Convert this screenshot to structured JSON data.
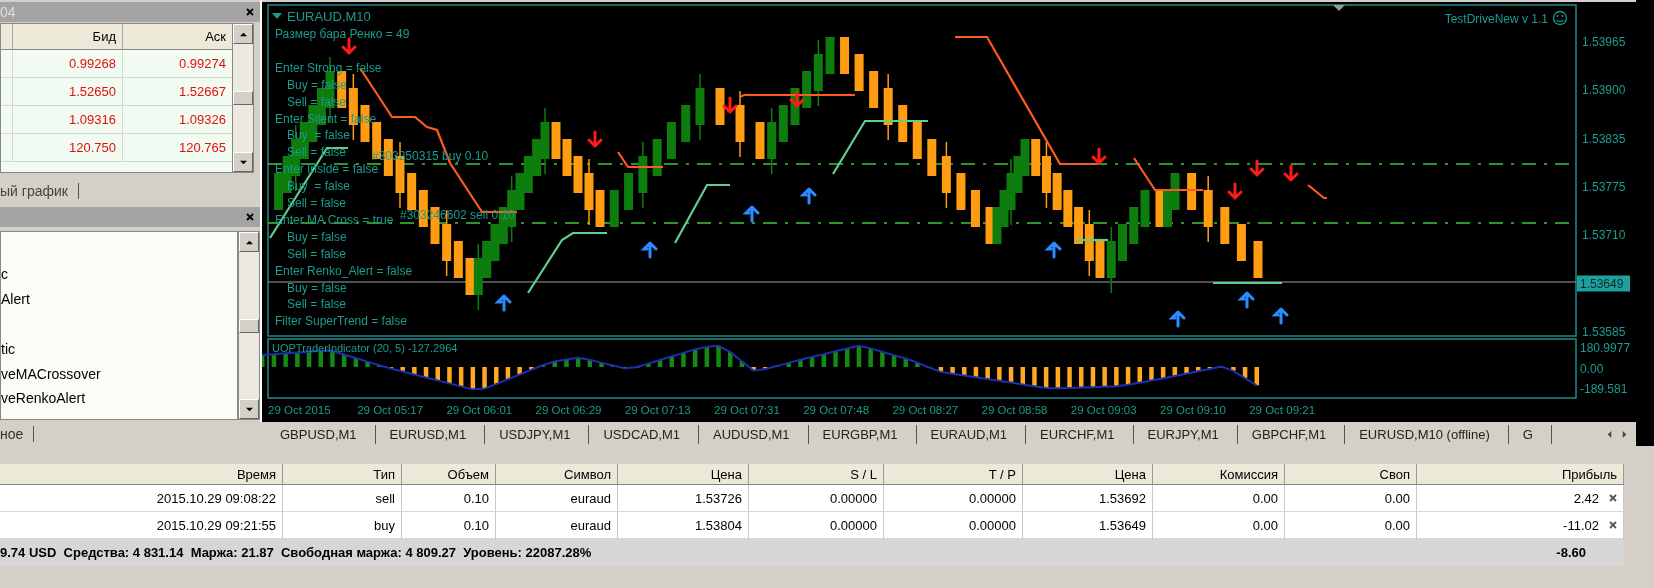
{
  "market_watch": {
    "title": "04",
    "columns": [
      "Бид",
      "Аск"
    ],
    "rows": [
      {
        "bid": "0.99268",
        "ask": "0.99274"
      },
      {
        "bid": "1.52650",
        "ask": "1.52667"
      },
      {
        "bid": "1.09316",
        "ask": "1.09326"
      },
      {
        "bid": "120.750",
        "ask": "120.765"
      }
    ],
    "tab": "ый график"
  },
  "navigator": {
    "items": [
      "c",
      "Alert",
      "tic",
      "veMACrossover",
      "veRenkoAlert"
    ],
    "tab": "ное"
  },
  "chart": {
    "title": "EURAUD,M10",
    "expert": "TestDriveNew v 1.1",
    "info": [
      {
        "text": "Размер бара Ренко = 49"
      },
      {
        "text": "Enter Strong = false",
        "children": [
          {
            "text": "Buy = false"
          },
          {
            "text": "Sell = false"
          }
        ]
      },
      {
        "text": "Enter Silent = false",
        "children": [
          {
            "text": "Buy  = false"
          },
          {
            "text": "Sell = false"
          }
        ]
      },
      {
        "text": "Enter Inside = false",
        "children": [
          {
            "text": "Buy  = false"
          },
          {
            "text": "Sell = false"
          }
        ]
      },
      {
        "text": "Enter MA Cross = true",
        "children": [
          {
            "text": "Buy = false"
          },
          {
            "text": "Sell = false"
          }
        ]
      },
      {
        "text": "Enter Renko_Alert = false",
        "children": [
          {
            "text": "Buy = false"
          },
          {
            "text": "Sell = false"
          }
        ]
      },
      {
        "text": "Filter SuperTrend = false"
      }
    ],
    "trade_labels": [
      "#303250315 buy 0.10",
      "#303246602 sell 0.10"
    ],
    "price_labels": [
      {
        "text": "1.53965",
        "kind": "tick"
      },
      {
        "text": "1.53900",
        "kind": "tick"
      },
      {
        "text": "1.53835",
        "kind": "tick"
      },
      {
        "text": "1.53775",
        "kind": "tick"
      },
      {
        "text": "1.53710",
        "kind": "tick"
      },
      {
        "text": "1.53649",
        "kind": "current"
      },
      {
        "text": "1.53585",
        "kind": "tick"
      }
    ],
    "indicator": {
      "label": "UOPTraderIndicator (20, 5) -127.2964",
      "labels": [
        "180.9977",
        "0.00",
        "-189.581"
      ]
    },
    "time_labels": [
      "29 Oct 2015",
      "29 Oct 05:17",
      "29 Oct 06:01",
      "29 Oct 06:29",
      "29 Oct 07:13",
      "29 Oct 07:31",
      "29 Oct 07:48",
      "29 Oct 08:27",
      "29 Oct 08:58",
      "29 Oct 09:03",
      "29 Oct 09:10",
      "29 Oct 09:21"
    ]
  },
  "chart_tabs": [
    "GBPUSD,M1",
    "EURUSD,M1",
    "USDJPY,M1",
    "USDCAD,M1",
    "AUDUSD,M1",
    "EURGBP,M1",
    "EURAUD,M1",
    "EURCHF,M1",
    "EURJPY,M1",
    "GBPCHF,M1",
    "EURUSD,M10 (offline)",
    "G"
  ],
  "trades": {
    "columns": [
      "Время",
      "Тип",
      "Объем",
      "Символ",
      "Цена",
      "S / L",
      "T / P",
      "Цена",
      "Комиссия",
      "Своп",
      "Прибыль"
    ],
    "rows": [
      [
        "2015.10.29 09:08:22",
        "sell",
        "0.10",
        "euraud",
        "1.53726",
        "0.00000",
        "0.00000",
        "1.53692",
        "0.00",
        "0.00",
        "2.42"
      ],
      [
        "2015.10.29 09:21:55",
        "buy",
        "0.10",
        "euraud",
        "1.53804",
        "0.00000",
        "0.00000",
        "1.53649",
        "0.00",
        "0.00",
        "-11.02"
      ]
    ],
    "summary": "9.74 USD  Средства: 4 831.14  Маржа: 21.87  Свободная маржа: 4 809.27  Уровень: 22087.28%",
    "total": "-8.60"
  }
}
